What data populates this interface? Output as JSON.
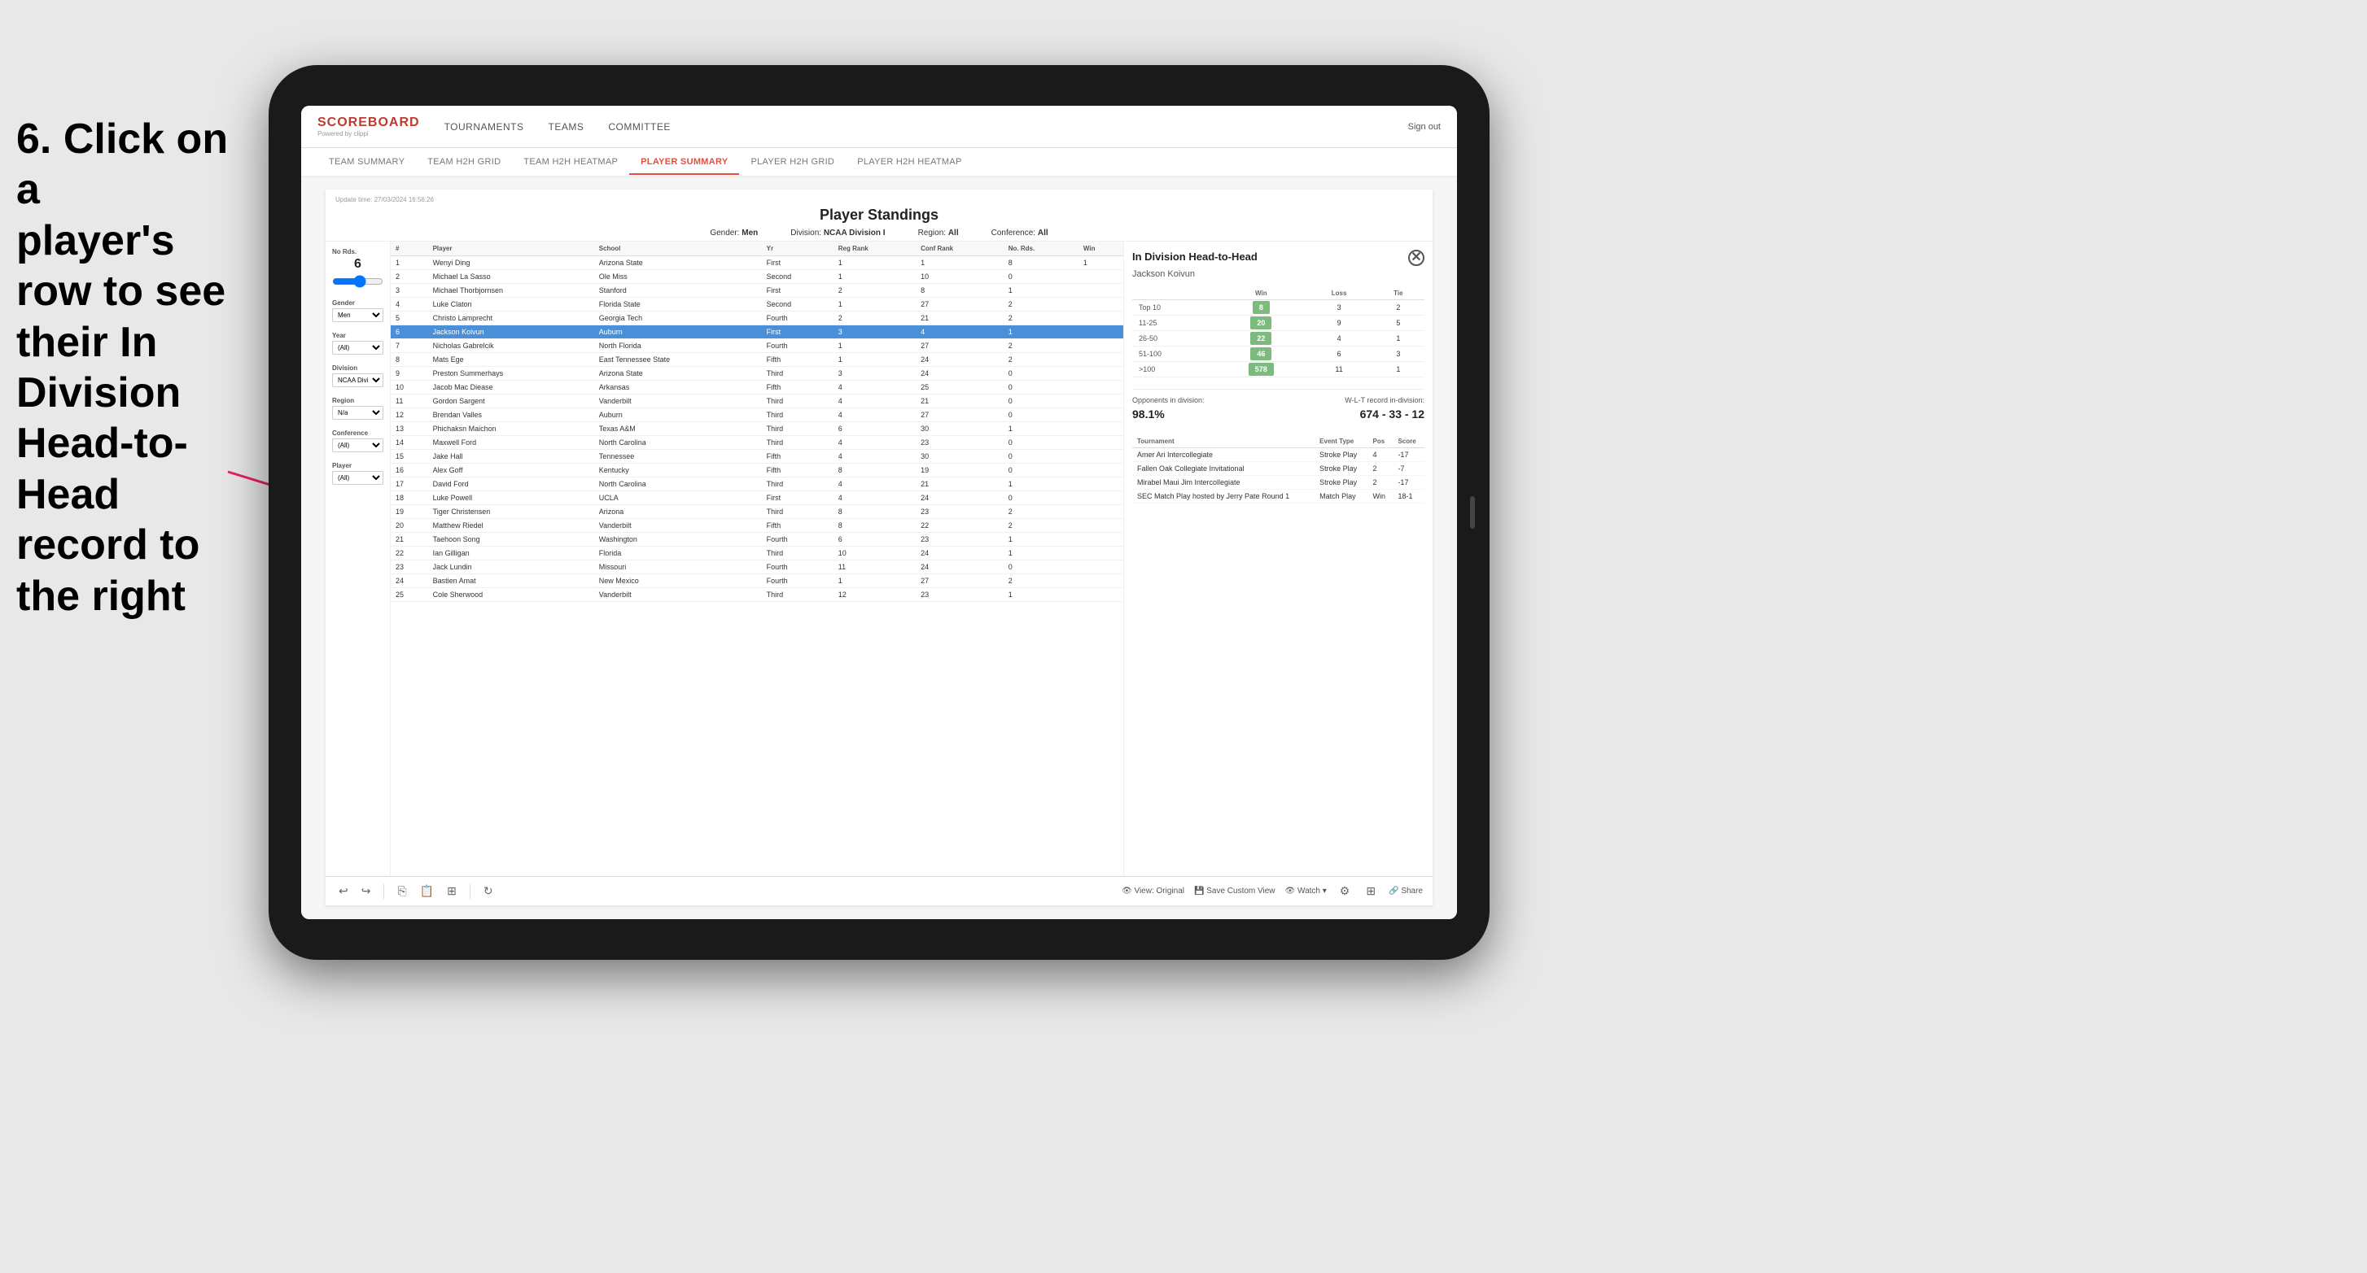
{
  "instruction": {
    "line1": "6. Click on a",
    "line2": "player's row to see",
    "line3": "their In Division",
    "line4": "Head-to-Head",
    "line5": "record to the right"
  },
  "nav": {
    "logo": "SCOREBOARD",
    "logo_sub": "Powered by clippi",
    "items": [
      "TOURNAMENTS",
      "TEAMS",
      "COMMITTEE"
    ],
    "sign_out": "Sign out"
  },
  "sub_nav": {
    "items": [
      "TEAM SUMMARY",
      "TEAM H2H GRID",
      "TEAM H2H HEATMAP",
      "PLAYER SUMMARY",
      "PLAYER H2H GRID",
      "PLAYER H2H HEATMAP"
    ],
    "active": "PLAYER SUMMARY"
  },
  "standings": {
    "update_time": "Update time:",
    "update_date": "27/03/2024 16:56:26",
    "title": "Player Standings",
    "gender_label": "Gender:",
    "gender_value": "Men",
    "division_label": "Division:",
    "division_value": "NCAA Division I",
    "region_label": "Region:",
    "region_value": "All",
    "conference_label": "Conference:",
    "conference_value": "All"
  },
  "sidebar": {
    "rounds_label": "No Rds.",
    "rounds_value": "6",
    "gender_label": "Gender",
    "gender_value": "Men",
    "year_label": "Year",
    "year_value": "(All)",
    "division_label": "Division",
    "division_value": "NCAA Division I",
    "region_label": "Region",
    "region_value": "N/a",
    "conference_label": "Conference",
    "conference_value": "(All)",
    "player_label": "Player",
    "player_value": "(All)"
  },
  "table": {
    "headers": [
      "#",
      "Player",
      "School",
      "Yr",
      "Reg Rank",
      "Conf Rank",
      "No. Rds.",
      "Win"
    ],
    "rows": [
      {
        "num": "1",
        "player": "Wenyi Ding",
        "school": "Arizona State",
        "yr": "First",
        "reg_rank": "1",
        "conf_rank": "1",
        "rds": "8",
        "win": "1"
      },
      {
        "num": "2",
        "player": "Michael La Sasso",
        "school": "Ole Miss",
        "yr": "Second",
        "reg_rank": "1",
        "conf_rank": "10",
        "rds": "0",
        "win": ""
      },
      {
        "num": "3",
        "player": "Michael Thorbjornsen",
        "school": "Stanford",
        "yr": "First",
        "reg_rank": "2",
        "conf_rank": "8",
        "rds": "1",
        "win": ""
      },
      {
        "num": "4",
        "player": "Luke Claton",
        "school": "Florida State",
        "yr": "Second",
        "reg_rank": "1",
        "conf_rank": "27",
        "rds": "2",
        "win": ""
      },
      {
        "num": "5",
        "player": "Christo Lamprecht",
        "school": "Georgia Tech",
        "yr": "Fourth",
        "reg_rank": "2",
        "conf_rank": "21",
        "rds": "2",
        "win": ""
      },
      {
        "num": "6",
        "player": "Jackson Koivun",
        "school": "Auburn",
        "yr": "First",
        "reg_rank": "3",
        "conf_rank": "4",
        "rds": "1",
        "win": "",
        "highlighted": true
      },
      {
        "num": "7",
        "player": "Nicholas Gabrelcik",
        "school": "North Florida",
        "yr": "Fourth",
        "reg_rank": "1",
        "conf_rank": "27",
        "rds": "2",
        "win": ""
      },
      {
        "num": "8",
        "player": "Mats Ege",
        "school": "East Tennessee State",
        "yr": "Fifth",
        "reg_rank": "1",
        "conf_rank": "24",
        "rds": "2",
        "win": ""
      },
      {
        "num": "9",
        "player": "Preston Summerhays",
        "school": "Arizona State",
        "yr": "Third",
        "reg_rank": "3",
        "conf_rank": "24",
        "rds": "0",
        "win": ""
      },
      {
        "num": "10",
        "player": "Jacob Mac Diease",
        "school": "Arkansas",
        "yr": "Fifth",
        "reg_rank": "4",
        "conf_rank": "25",
        "rds": "0",
        "win": ""
      },
      {
        "num": "11",
        "player": "Gordon Sargent",
        "school": "Vanderbilt",
        "yr": "Third",
        "reg_rank": "4",
        "conf_rank": "21",
        "rds": "0",
        "win": ""
      },
      {
        "num": "12",
        "player": "Brendan Valles",
        "school": "Auburn",
        "yr": "Third",
        "reg_rank": "4",
        "conf_rank": "27",
        "rds": "0",
        "win": ""
      },
      {
        "num": "13",
        "player": "Phichaksn Maichon",
        "school": "Texas A&M",
        "yr": "Third",
        "reg_rank": "6",
        "conf_rank": "30",
        "rds": "1",
        "win": ""
      },
      {
        "num": "14",
        "player": "Maxwell Ford",
        "school": "North Carolina",
        "yr": "Third",
        "reg_rank": "4",
        "conf_rank": "23",
        "rds": "0",
        "win": ""
      },
      {
        "num": "15",
        "player": "Jake Hall",
        "school": "Tennessee",
        "yr": "Fifth",
        "reg_rank": "4",
        "conf_rank": "30",
        "rds": "0",
        "win": ""
      },
      {
        "num": "16",
        "player": "Alex Goff",
        "school": "Kentucky",
        "yr": "Fifth",
        "reg_rank": "8",
        "conf_rank": "19",
        "rds": "0",
        "win": ""
      },
      {
        "num": "17",
        "player": "David Ford",
        "school": "North Carolina",
        "yr": "Third",
        "reg_rank": "4",
        "conf_rank": "21",
        "rds": "1",
        "win": ""
      },
      {
        "num": "18",
        "player": "Luke Powell",
        "school": "UCLA",
        "yr": "First",
        "reg_rank": "4",
        "conf_rank": "24",
        "rds": "0",
        "win": ""
      },
      {
        "num": "19",
        "player": "Tiger Christensen",
        "school": "Arizona",
        "yr": "Third",
        "reg_rank": "8",
        "conf_rank": "23",
        "rds": "2",
        "win": ""
      },
      {
        "num": "20",
        "player": "Matthew Riedel",
        "school": "Vanderbilt",
        "yr": "Fifth",
        "reg_rank": "8",
        "conf_rank": "22",
        "rds": "2",
        "win": ""
      },
      {
        "num": "21",
        "player": "Taehoon Song",
        "school": "Washington",
        "yr": "Fourth",
        "reg_rank": "6",
        "conf_rank": "23",
        "rds": "1",
        "win": ""
      },
      {
        "num": "22",
        "player": "Ian Gilligan",
        "school": "Florida",
        "yr": "Third",
        "reg_rank": "10",
        "conf_rank": "24",
        "rds": "1",
        "win": ""
      },
      {
        "num": "23",
        "player": "Jack Lundin",
        "school": "Missouri",
        "yr": "Fourth",
        "reg_rank": "11",
        "conf_rank": "24",
        "rds": "0",
        "win": ""
      },
      {
        "num": "24",
        "player": "Bastien Amat",
        "school": "New Mexico",
        "yr": "Fourth",
        "reg_rank": "1",
        "conf_rank": "27",
        "rds": "2",
        "win": ""
      },
      {
        "num": "25",
        "player": "Cole Sherwood",
        "school": "Vanderbilt",
        "yr": "Third",
        "reg_rank": "12",
        "conf_rank": "23",
        "rds": "1",
        "win": ""
      }
    ]
  },
  "h2h": {
    "title": "In Division Head-to-Head",
    "player_name": "Jackson Koivun",
    "table_headers": [
      "",
      "Win",
      "Loss",
      "Tie"
    ],
    "rows": [
      {
        "rank": "Top 10",
        "win": "8",
        "loss": "3",
        "tie": "2"
      },
      {
        "rank": "11-25",
        "win": "20",
        "loss": "9",
        "tie": "5"
      },
      {
        "rank": "26-50",
        "win": "22",
        "loss": "4",
        "tie": "1"
      },
      {
        "rank": "51-100",
        "win": "46",
        "loss": "6",
        "tie": "3"
      },
      {
        "rank": ">100",
        "win": "578",
        "loss": "11",
        "tie": "1"
      }
    ],
    "opponents_label": "Opponents in division:",
    "wlt_label": "W-L-T record in-division:",
    "opponents_pct": "98.1%",
    "record": "674 - 33 - 12",
    "tournament_headers": [
      "Tournament",
      "Event Type",
      "Pos",
      "Score"
    ],
    "tournaments": [
      {
        "name": "Amer Ari Intercollegiate",
        "type": "Stroke Play",
        "pos": "4",
        "score": "-17"
      },
      {
        "name": "Fallen Oak Collegiate Invitational",
        "type": "Stroke Play",
        "pos": "2",
        "score": "-7"
      },
      {
        "name": "Mirabel Maui Jim Intercollegiate",
        "type": "Stroke Play",
        "pos": "2",
        "score": "-17"
      },
      {
        "name": "SEC Match Play hosted by Jerry Pate Round 1",
        "type": "Match Play",
        "pos": "Win",
        "score": "18-1"
      }
    ]
  },
  "toolbar": {
    "undo": "↩",
    "redo": "↪",
    "view_original": "View: Original",
    "save_custom": "Save Custom View",
    "watch": "Watch ▾",
    "share": "Share"
  }
}
